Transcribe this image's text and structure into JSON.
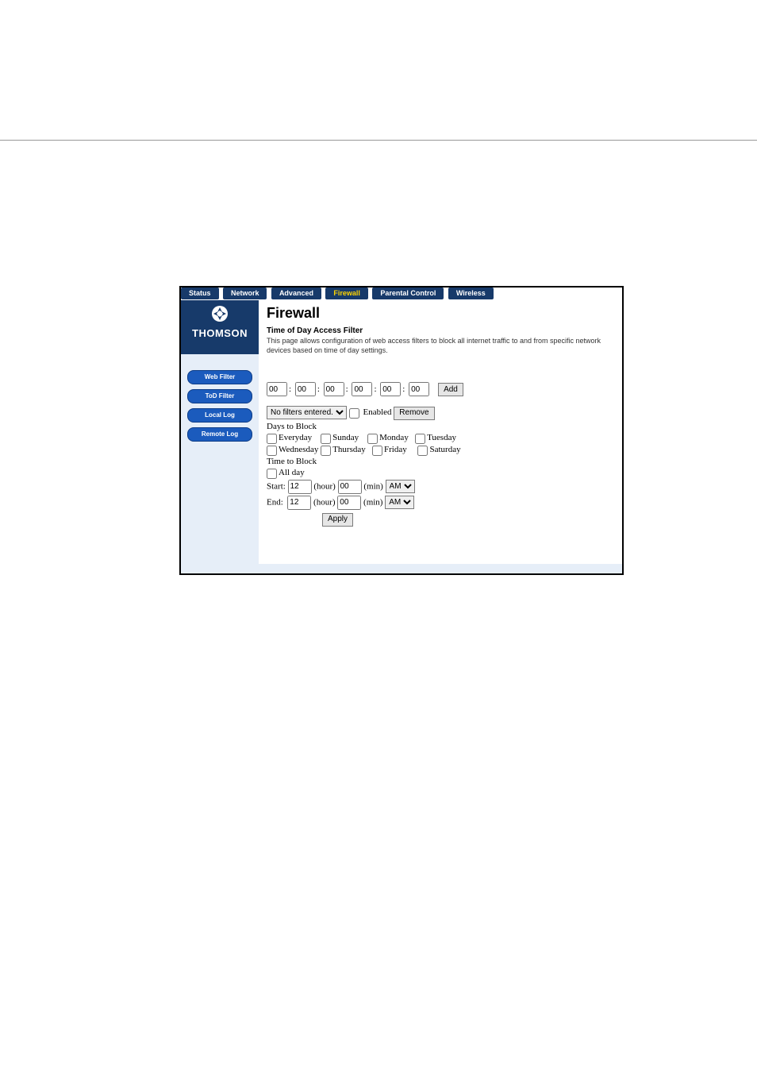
{
  "topnav": {
    "items": [
      "Status",
      "Network",
      "Advanced",
      "Firewall",
      "Parental Control",
      "Wireless"
    ],
    "active_index": 3
  },
  "brand": {
    "name": "THOMSON"
  },
  "sidebar": {
    "items": [
      {
        "label": "Web Filter"
      },
      {
        "label": "ToD Filter"
      },
      {
        "label": "Local Log"
      },
      {
        "label": "Remote Log"
      }
    ]
  },
  "page": {
    "title": "Firewall",
    "subtitle": "Time of Day Access Filter",
    "description": "This page allows configuration of web access filters to block all internet traffic to and from specific network devices based on time of day settings."
  },
  "mac": {
    "fields": [
      "00",
      "00",
      "00",
      "00",
      "00",
      "00"
    ],
    "add_label": "Add"
  },
  "filter": {
    "select_value": "No filters entered.",
    "enabled_label": "Enabled",
    "remove_label": "Remove"
  },
  "days": {
    "header": "Days to Block",
    "items": [
      "Everyday",
      "Sunday",
      "Monday",
      "Tuesday",
      "Wednesday",
      "Thursday",
      "Friday",
      "Saturday"
    ]
  },
  "time": {
    "header": "Time to Block",
    "allday_label": "All day",
    "start_label": "Start:",
    "end_label": "End:",
    "hour_label": "(hour)",
    "min_label": "(min)",
    "start_hour": "12",
    "start_min": "00",
    "start_ampm": "AM",
    "end_hour": "12",
    "end_min": "00",
    "end_ampm": "AM",
    "am_option": "AM"
  },
  "apply_label": "Apply"
}
